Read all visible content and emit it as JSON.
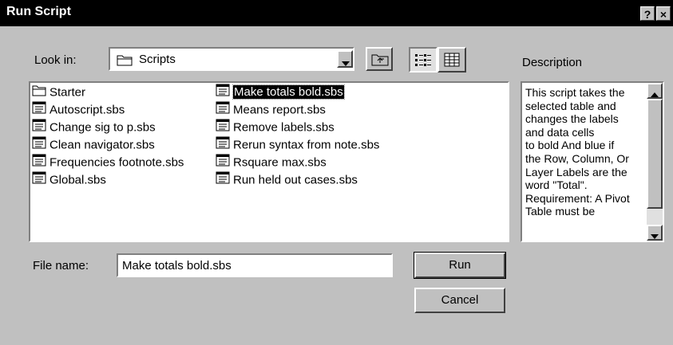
{
  "window": {
    "title": "Run Script",
    "help_label": "?",
    "close_label": "×"
  },
  "look_in": {
    "label": "Look in:",
    "value": "Scripts"
  },
  "description": {
    "label": "Description",
    "text": "This script takes the\nselected table and\nchanges the labels\nand data cells\nto bold And blue if\nthe Row, Column, Or\nLayer Labels are the\nword \"Total\".\nRequirement: A Pivot\nTable must be"
  },
  "files": [
    {
      "name": "Starter",
      "type": "folder"
    },
    {
      "name": "Autoscript.sbs",
      "type": "script"
    },
    {
      "name": "Change sig to p.sbs",
      "type": "script"
    },
    {
      "name": "Clean navigator.sbs",
      "type": "script"
    },
    {
      "name": "Frequencies footnote.sbs",
      "type": "script"
    },
    {
      "name": "Global.sbs",
      "type": "script"
    },
    {
      "name": "Make totals bold.sbs",
      "type": "script",
      "selected": true
    },
    {
      "name": "Means report.sbs",
      "type": "script"
    },
    {
      "name": "Remove labels.sbs",
      "type": "script"
    },
    {
      "name": "Rerun syntax from note.sbs",
      "type": "script"
    },
    {
      "name": "Rsquare max.sbs",
      "type": "script"
    },
    {
      "name": "Run held out cases.sbs",
      "type": "script"
    }
  ],
  "file_name": {
    "label": "File name:",
    "value": "Make totals bold.sbs"
  },
  "buttons": {
    "run": "Run",
    "cancel": "Cancel"
  },
  "icons": {
    "folder": "folder-icon",
    "script": "script-file-icon",
    "up": "up-folder-icon",
    "list_view": "list-view-icon",
    "details_view": "details-view-icon"
  }
}
